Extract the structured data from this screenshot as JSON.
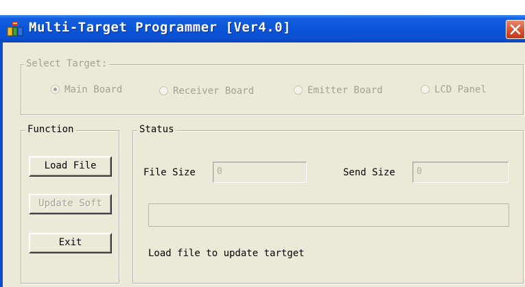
{
  "window": {
    "title": "Multi-Target Programmer [Ver4.0]"
  },
  "select_target": {
    "legend": "Select Target:",
    "options": [
      {
        "label": "Main Board",
        "checked": true
      },
      {
        "label": "Receiver Board",
        "checked": false
      },
      {
        "label": "Emitter Board",
        "checked": false
      },
      {
        "label": "LCD Panel",
        "checked": false
      }
    ]
  },
  "function": {
    "legend": "Function",
    "load_file_label": "Load File",
    "update_soft_label": "Update Soft",
    "exit_label": "Exit"
  },
  "status": {
    "legend": "Status",
    "file_size_label": "File Size",
    "file_size_value": "0",
    "send_size_label": "Send Size",
    "send_size_value": "0",
    "progress": 0,
    "message": "Load file to update tartget"
  },
  "icons": {
    "app": "app-icon",
    "close": "close-icon"
  },
  "colors": {
    "titlebar": "#0b4fd0",
    "dialog_bg": "#ece9d8",
    "close_button": "#d5542f",
    "disabled_text": "#a4a093"
  }
}
